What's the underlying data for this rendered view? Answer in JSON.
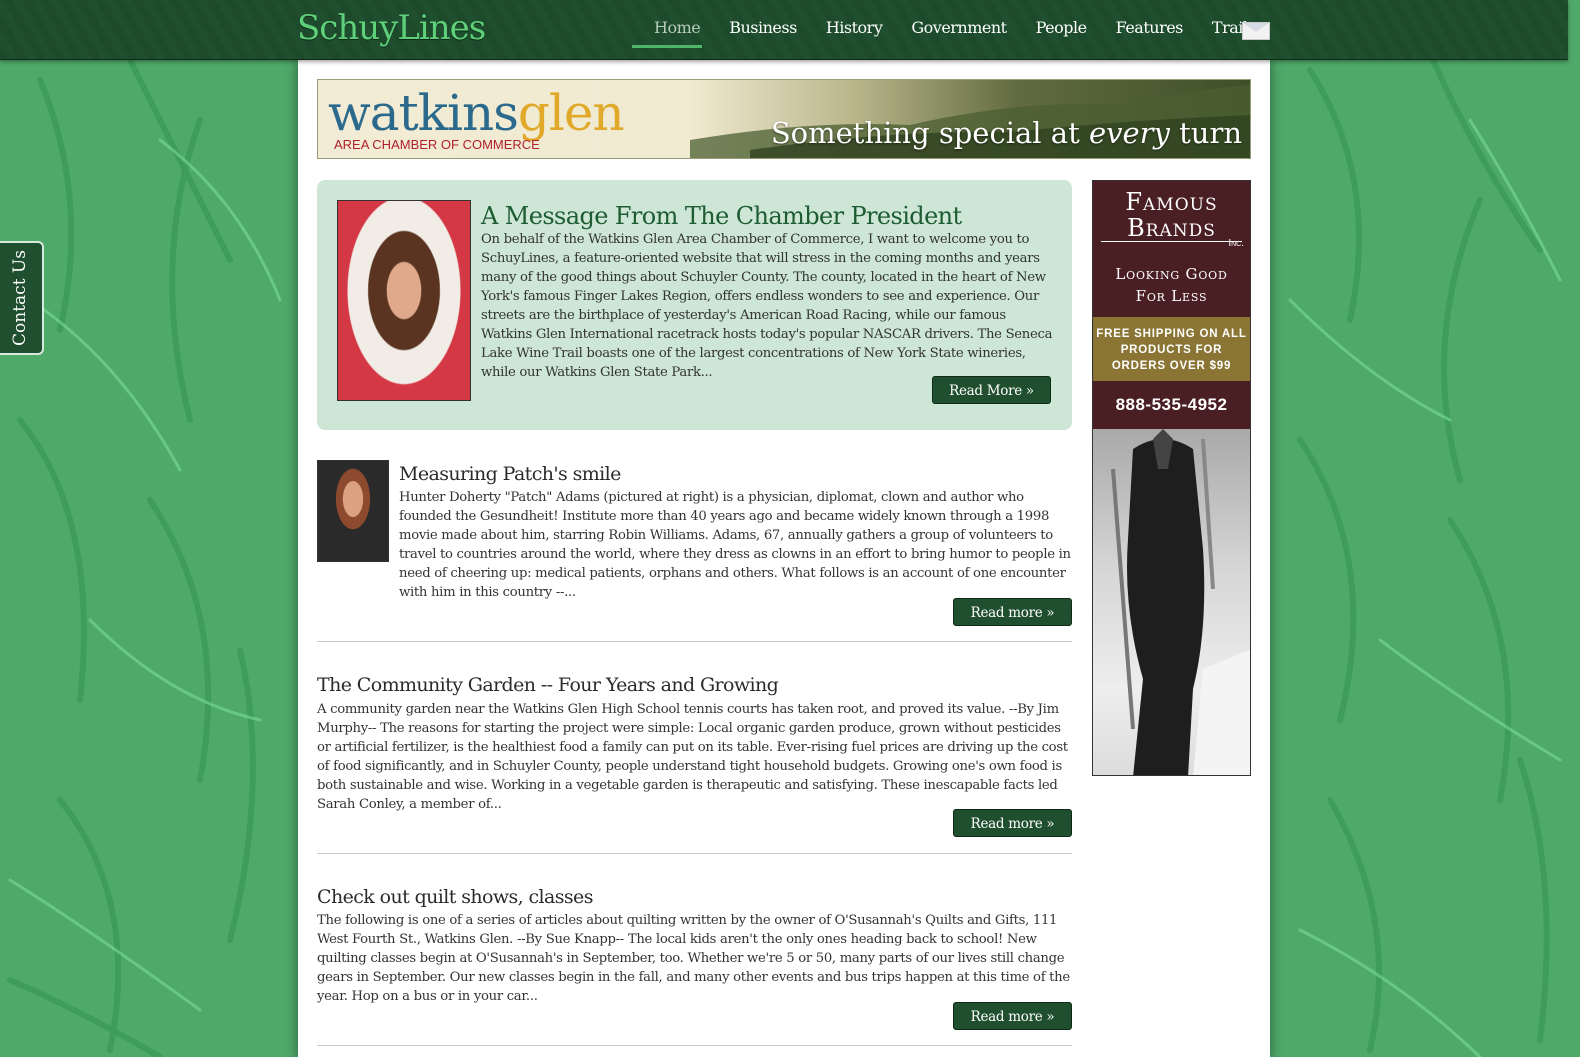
{
  "site": {
    "logo": "SchuyLines",
    "nav": [
      "Home",
      "Business",
      "History",
      "Government",
      "People",
      "Features",
      "Trails"
    ],
    "contact_tab": "Contact Us"
  },
  "banner": {
    "title_part1": "watkins",
    "title_part2": "glen",
    "subtitle": "AREA CHAMBER OF COMMERCE",
    "tagline_pre": "Something special at ",
    "tagline_em": "every",
    "tagline_post": " turn"
  },
  "president": {
    "title": "A Message From The Chamber President",
    "body": "On behalf of the Watkins Glen Area Chamber of Commerce, I want to welcome you to SchuyLines, a feature-oriented website that will stress in the coming months and years many of the good things about Schuyler County. The county, located in the heart of New York's famous Finger Lakes Region, offers endless wonders to see and experience. Our streets are the birthplace of yesterday's American Road Racing, while our famous Watkins Glen International racetrack hosts today's popular NASCAR drivers.  The Seneca Lake Wine Trail boasts one of the largest concentrations of New York State wineries, while our Watkins Glen State Park...",
    "button": "Read More »"
  },
  "articles": [
    {
      "title": "Measuring Patch's smile",
      "body": "Hunter Doherty \"Patch\" Adams (pictured at right) is a physician, diplomat, clown and author who founded the Gesundheit! Institute more than 40 years ago and became widely known through  a 1998 movie made about him, starring Robin Williams.  Adams, 67, annually gathers a group of volunteers to travel to countries around the world, where they dress as clowns in an effort to bring humor to people in need of cheering up: medical patients, orphans and others. What follows is an account of one encounter with him in this country --...",
      "button": "Read more »"
    },
    {
      "title": "The Community Garden -- Four Years and Growing",
      "body": "A community garden near the Watkins Glen High School tennis courts has taken root, and proved its value. --By Jim Murphy-- The reasons for starting the project were simple: Local organic garden produce, grown without pesticides or artificial fertilizer, is the healthiest food a family can put on its table. Ever-rising fuel prices are driving up the cost of food significantly, and in Schuyler County, people understand tight household budgets. Growing one's own food is both sustainable and wise. Working in a vegetable garden is therapeutic and satisfying. These inescapable facts led Sarah Conley, a member of...",
      "button": "Read more »"
    },
    {
      "title": "Check out quilt shows, classes",
      "body": "The following is one of a series of articles about quilting written by the owner of O'Susannah's Quilts and Gifts, 111 West Fourth St., Watkins Glen. --By Sue Knapp-- The local kids aren't the only ones heading back to school! New quilting classes begin at O'Susannah's in September, too. Whether we're 5 or 50, many parts of our lives still change gears in September. Our new classes begin in the fall, and many other events and bus trips happen at this time of the year.  Hop on a bus or in your car...",
      "button": "Read more »"
    }
  ],
  "ad": {
    "brand_line1": "Famous",
    "brand_line2": "Brands",
    "brand_inc": "Inc.",
    "tag_line1": "Looking Good",
    "tag_line2": "For Less",
    "shipping": "FREE SHIPPING ON ALL PRODUCTS FOR ORDERS OVER $99",
    "phone": "888-535-4952"
  }
}
